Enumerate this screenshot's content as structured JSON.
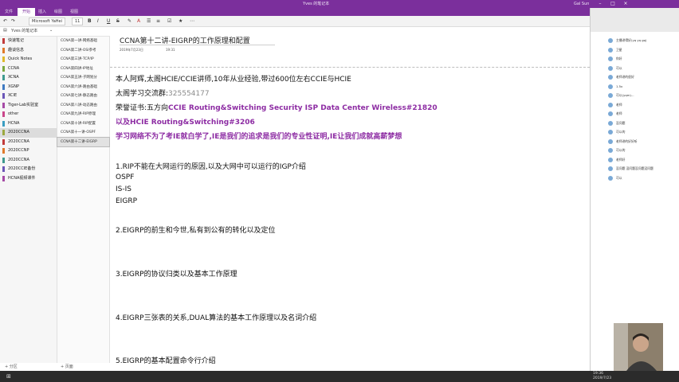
{
  "window": {
    "title": "Yves 的笔记本",
    "account": "Gal Sun"
  },
  "ribbon": {
    "tabs": [
      "文件",
      "开始",
      "插入",
      "绘图",
      "视图"
    ],
    "active": "开始"
  },
  "toolbar": {
    "font": "Microsoft YaHei",
    "size": "11",
    "bold": "B",
    "italic": "I",
    "underline": "U",
    "strike": "S"
  },
  "notebook": {
    "name": "Yves 的笔记本"
  },
  "sections": [
    {
      "label": "快速笔记",
      "color": "#c13b3b"
    },
    {
      "label": "趣谈信息",
      "color": "#e07a2b"
    },
    {
      "label": "Quick Notes",
      "color": "#e0b92b"
    },
    {
      "label": "CCNA",
      "color": "#7aa83f"
    },
    {
      "label": "XCNA",
      "color": "#3e9a8f"
    },
    {
      "label": "XGNP",
      "color": "#3f7ac2"
    },
    {
      "label": "XCIE",
      "color": "#6b56b8"
    },
    {
      "label": "Tiger-Lab实验室",
      "color": "#a64aa6"
    },
    {
      "label": "other",
      "color": "#c9468a"
    },
    {
      "label": "HCNA",
      "color": "#3b9ec2"
    },
    {
      "label": "2020CCNA",
      "color": "#9ba83f"
    },
    {
      "label": "2020CCNA",
      "color": "#c13b3b"
    },
    {
      "label": "2020CCNP",
      "color": "#e07a2b"
    },
    {
      "label": "2020CCNA",
      "color": "#3e9a8f"
    },
    {
      "label": "2020CCIE备份",
      "color": "#6b56b8"
    },
    {
      "label": "HCNA视频课件",
      "color": "#a64aa6"
    }
  ],
  "pages": [
    "CCNA第一讲-网络基础",
    "CCNA第二讲-OSI参考",
    "CCNA第三讲-TCP/IP",
    "CCNA第四讲-IP地址",
    "CCNA第五讲-子网划分",
    "CCNA第六讲-路由基础",
    "CCNA第七讲-静态路由",
    "CCNA第八讲-动态路由",
    "CCNA第九讲-RIP原理",
    "CCNA第十讲-RIP配置",
    "CCNA第十一讲-OSPF",
    "CCNA第十二讲-EIGRP"
  ],
  "add_section": "+ 分区",
  "add_page": "+ 页面",
  "page": {
    "title": "CCNA第十二讲-EIGRP的工作原理和配置",
    "date": "2019年7月23日",
    "time": "19:31",
    "intro1": "本人阿辉,太阁HCIE/CCIE讲师,10年从业经验,带过600位左右CCIE与HCIE",
    "intro2_label": "太阁学习交流群:",
    "intro2_value": "325554177",
    "intro3_label": "荣誉证书:五方向",
    "intro3_value": "CCIE Routing&Switching Security ISP Data Center Wireless#21820",
    "intro4": "以及HCIE Routing&Switching#3206",
    "intro5": "学习网络不为了考IE就白学了,IE是我们的追求是我们的专业性证明,IE让我们成就高薪梦想",
    "item1": "1.RIP不能在大网运行的原因,以及大网中可以运行的IGP介绍",
    "item1a": "OSPF",
    "item1b": "IS-IS",
    "item1c": "EIGRP",
    "item2": "2.EIGRP的前生和今世,私有到公有的转化以及定位",
    "item3": "3.EIGRP的协议归类以及基本工作原理",
    "item4": "4.EIGRP三张表的关系,DUAL算法的基本工作原理以及名词介绍",
    "item5": "5.EIGRP的基本配置命令行介绍"
  },
  "chat": {
    "messages": [
      "主播讲得好(yq yq gq)",
      "卫星",
      "你好",
      "可以",
      "老师讲的很好",
      "1.5x",
      "可以(yqm)...",
      "老师",
      "老师",
      "没问题",
      "可以的",
      "老师讲的好好听",
      "可以的",
      "老师好",
      "没问题 没问题没问题没问题",
      "可以"
    ]
  },
  "taskbar": {
    "time": "19:36",
    "date": "2019/7/23"
  }
}
